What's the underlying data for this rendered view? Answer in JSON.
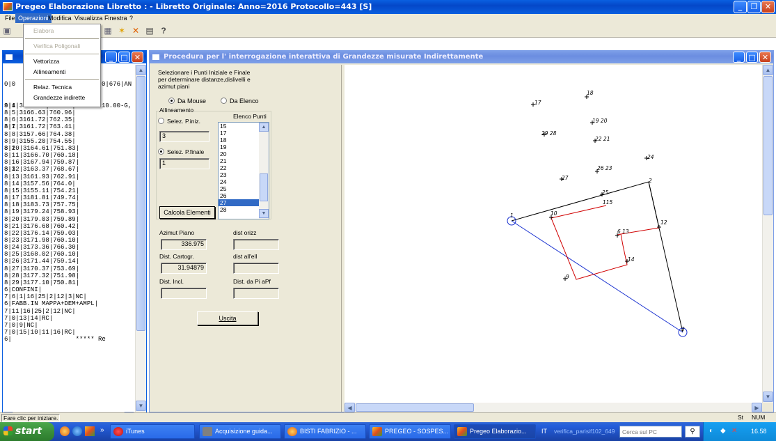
{
  "main_window": {
    "title": "Pregeo Elaborazione Libretto : - Libretto Originale: Anno=2016 Protocollo=443 [S]"
  },
  "menubar": {
    "items": [
      "File",
      "Operazioni",
      "Modifica",
      "Visualizza",
      "Finestra",
      "?"
    ]
  },
  "operazioni_menu": {
    "items": [
      {
        "label": "Elabora",
        "enabled": false
      },
      {
        "label": "Verifica Poligonali",
        "enabled": false
      },
      {
        "label": "Vettorizza",
        "enabled": true
      },
      {
        "label": "Allineamenti",
        "enabled": true
      },
      {
        "label": "Relaz. Tecnica",
        "enabled": true
      },
      {
        "label": "Grandezze indirette",
        "enabled": true
      }
    ]
  },
  "libretto_window": {
    "partial_lines": [
      "0|0",
      "9|1",
      "8|1",
      "8|2",
      "8|3"
    ],
    "partial_right": [
      "0|676|AN",
      "10.00-G,"
    ],
    "lines": [
      "8|4|3164.39|752.41|",
      "8|5|3166.63|760.96|",
      "8|6|3161.72|762.35|",
      "8|7|3161.72|763.41|",
      "8|8|3157.66|764.38|",
      "8|9|3155.20|754.55|",
      "8|10|3164.61|751.83|",
      "8|11|3166.70|760.18|",
      "8|16|3167.94|759.87|",
      "8|12|3163.37|768.67|",
      "8|13|3161.93|762.91|",
      "8|14|3157.56|764.0|",
      "8|15|3155.11|754.21|",
      "8|17|3181.81|749.74|",
      "8|18|3183.73|757.75|",
      "8|19|3179.24|758.93|",
      "8|20|3179.03|759.89|",
      "8|21|3176.68|760.42|",
      "8|22|3176.14|759.03|",
      "8|23|3171.98|760.10|",
      "8|24|3173.36|766.30|",
      "8|25|3168.02|760.10|",
      "8|26|3171.44|759.14|",
      "8|27|3170.37|753.69|",
      "8|28|3177.32|751.98|",
      "8|29|3177.10|750.81|",
      "6|CONFINI|",
      "7|6|1|16|25|2|12|3|NC|",
      "6|FABB.IN MAPPA+DEM+AMPL|",
      "7|11|16|25|2|12|NC|",
      "7|0|13|14|RC|",
      "7|0|9|NC|",
      "7|0|15|10|11|16|RC|",
      "6|                 ***** Re"
    ]
  },
  "procedura_window": {
    "title": "Procedura per l' interrogazione interattiva di Grandezze misurate Indirettamente",
    "instructions": [
      "Selezionare i Punti Iniziale e Finale",
      "per determinare distanze,dislivelli e",
      "azimut piani"
    ],
    "radio_mouse": "Da Mouse",
    "radio_elenco": "Da Elenco",
    "group_label": "Allineamento",
    "sel_iniz_label": "Selez. P.iniz.",
    "sel_iniz_value": "3",
    "sel_finale_label": "Selez. P.finale",
    "sel_finale_value": "1",
    "elenco_label": "Elenco Punti",
    "elenco_items": [
      "15",
      "17",
      "18",
      "19",
      "20",
      "21",
      "22",
      "23",
      "24",
      "25",
      "26",
      "27",
      "28"
    ],
    "elenco_selected": "27",
    "calcola_label": "Calcola Elementi",
    "azimut_label": "Azimut Piano",
    "azimut_value": "336.975",
    "dist_orizz_label": "dist orizz",
    "dist_orizz_value": "",
    "dist_cartogr_label": "Dist. Cartogr.",
    "dist_cartogr_value": "31.94879",
    "dist_all_label": "dist all'ell",
    "dist_all_value": "",
    "dist_incl_label": "Dist. Incl.",
    "dist_incl_value": "",
    "dist_pi_label": "Dist. da Pi aPf",
    "dist_pi_value": "",
    "uscita_label": "Uscita"
  },
  "plot": {
    "labels": [
      "18",
      "17",
      "19 20",
      "29 28",
      "22 21",
      "24",
      "26 23",
      "27",
      "25",
      "2",
      "115",
      "1",
      "10",
      "12",
      "6 13",
      "14",
      "9",
      "3"
    ]
  },
  "statusbar": {
    "message": "Fare clic per iniziare.",
    "st": "St",
    "num": "NUM"
  },
  "taskbar": {
    "start": "start",
    "tasks": [
      "iTunes",
      "Acquisizione guida...",
      "BISTI FABRIZIO - ...",
      "PREGEO - SOSPES...",
      "Pregeo Elaborazio..."
    ],
    "lang": "IT",
    "search_text": "verifica_parisif102_649",
    "search_placeholder": "Cerca sul PC",
    "clock": "16.58"
  },
  "colors": {
    "xp_blue": "#0a5fe0",
    "red_lines": "#d00000",
    "blue_line": "#2040e0"
  }
}
